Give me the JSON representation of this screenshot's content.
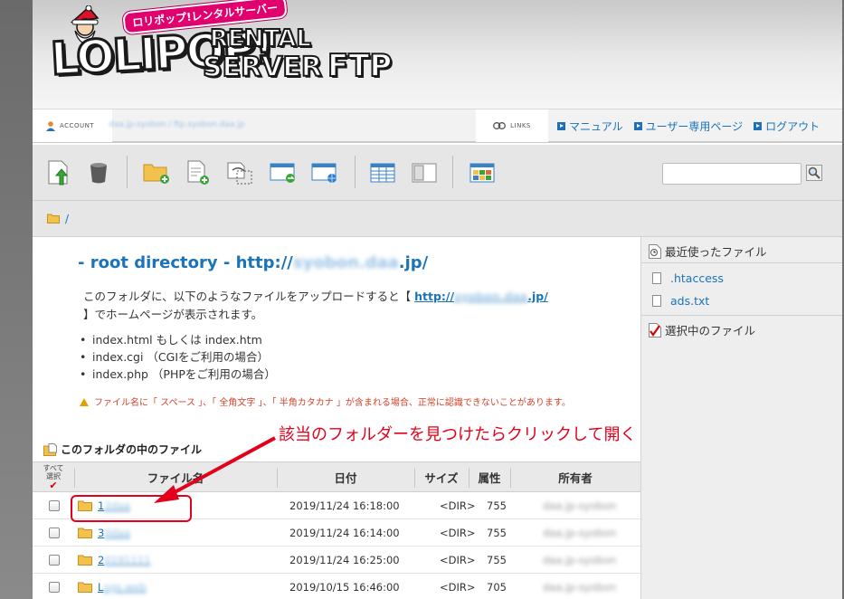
{
  "brand": {
    "pill": "ロリポップ!レンタルサーバー",
    "logo_main": "LOLIPOP!",
    "logo_rental": "RENTAL",
    "logo_server": "SERVER",
    "logo_ftp": "FTP"
  },
  "account": {
    "tab_label": "ACCOUNT",
    "value": "daa.jp-syobon / ftp.syobon.daa.jp"
  },
  "links": {
    "tab_label": "LINKS",
    "items": [
      "マニュアル",
      "ユーザー専用ページ",
      "ログアウト"
    ]
  },
  "breadcrumb": {
    "path": "/"
  },
  "main": {
    "title_prefix": "- root directory - http://",
    "title_host": "syobon.daa",
    "title_suffix": ".jp/",
    "desc_before": "このフォルダに、以下のようなファイルをアップロードすると【",
    "desc_link_prefix": "http://",
    "desc_link_host": "syobon.daa",
    "desc_link_suffix": ".jp/",
    "desc_after": "】でホームページが表示されます。",
    "index_files": [
      "index.html もしくは index.htm",
      "index.cgi （CGIをご利用の場合）",
      "index.php （PHPをご利用の場合）"
    ],
    "warning": "ファイル名に「 スペース 」、「 全角文字 」、「 半角カタカナ 」が含まれる場合、正常に認識できないことがあります。",
    "folder_heading": "このフォルダの中のファイル",
    "callout": "該当のフォルダーを見つけたらクリックして開く"
  },
  "table": {
    "select_all_line1": "すべて",
    "select_all_line2": "選択",
    "select_all_check": "✔",
    "columns": [
      "ファイル名",
      "日付",
      "サイズ",
      "属性",
      "所有者"
    ],
    "rows": [
      {
        "name_visible": "1",
        "name_hidden": "2daa",
        "date": "2019/11/24 16:18:00",
        "size": "<DIR>",
        "attr": "755",
        "owner": "daa.jp-syobon"
      },
      {
        "name_visible": "3",
        "name_hidden": "0daa",
        "date": "2019/11/24 16:14:00",
        "size": "<DIR>",
        "attr": "755",
        "owner": "daa.jp-syobon"
      },
      {
        "name_visible": "2",
        "name_hidden": "0191111",
        "date": "2019/11/24 16:25:00",
        "size": "<DIR>",
        "attr": "755",
        "owner": "daa.jp-syobon"
      },
      {
        "name_visible": "L",
        "name_hidden": "ogs.web",
        "date": "2019/10/15 16:46:00",
        "size": "<DIR>",
        "attr": "705",
        "owner": "daa.jp-syobon"
      }
    ]
  },
  "sidebar": {
    "recent_heading": "最近使ったファイル",
    "recent_files": [
      ".htaccess",
      "ads.txt"
    ],
    "selected_heading": "選択中のファイル"
  },
  "colors": {
    "link": "#1b73b8",
    "accent_red": "#e3001b",
    "warning": "#d0432b"
  }
}
